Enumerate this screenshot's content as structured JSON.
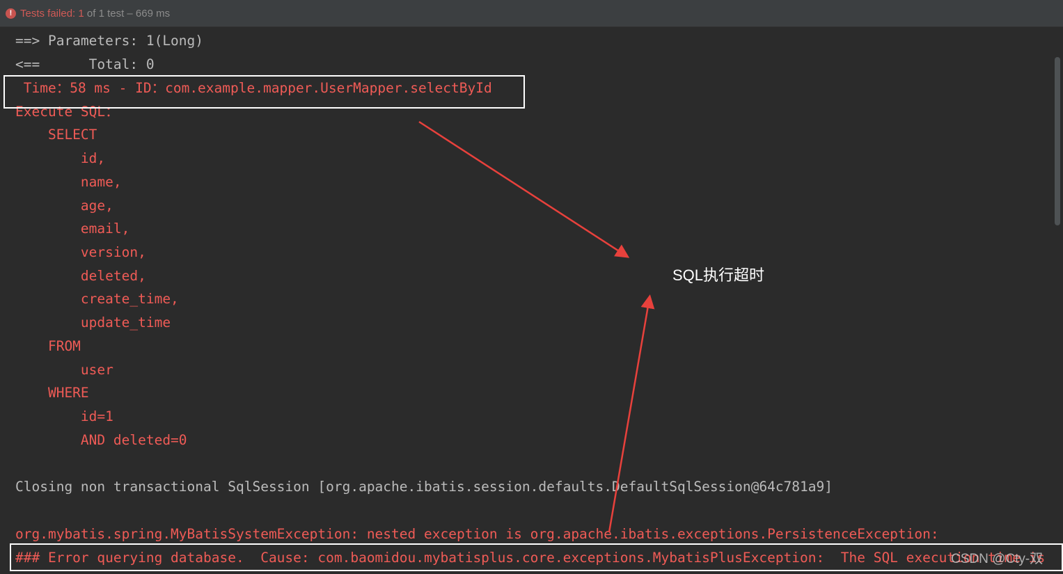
{
  "status": {
    "failed_label": "Tests failed: 1",
    "rest_label": " of 1 test – 669 ms"
  },
  "console_lines": [
    "==> Parameters: 1(Long)",
    "<==      Total: 0",
    " Time：58 ms - ID：com.example.mapper.UserMapper.selectById",
    "Execute SQL：",
    "    SELECT",
    "        id,",
    "        name,",
    "        age,",
    "        email,",
    "        version,",
    "        deleted,",
    "        create_time,",
    "        update_time",
    "    FROM",
    "        user",
    "    WHERE",
    "        id=1",
    "        AND deleted=0",
    "",
    "Closing non transactional SqlSession [org.apache.ibatis.session.defaults.DefaultSqlSession@64c781a9]",
    "",
    "org.mybatis.spring.MyBatisSystemException: nested exception is org.apache.ibatis.exceptions.PersistenceException: ",
    "### Error querying database.  Cause: com.baomidou.mybatisplus.core.exceptions.MybatisPlusException:  The SQL execution time is"
  ],
  "annotation": {
    "text": "SQL执行超时"
  },
  "watermark": "CSDN @Cty-双"
}
